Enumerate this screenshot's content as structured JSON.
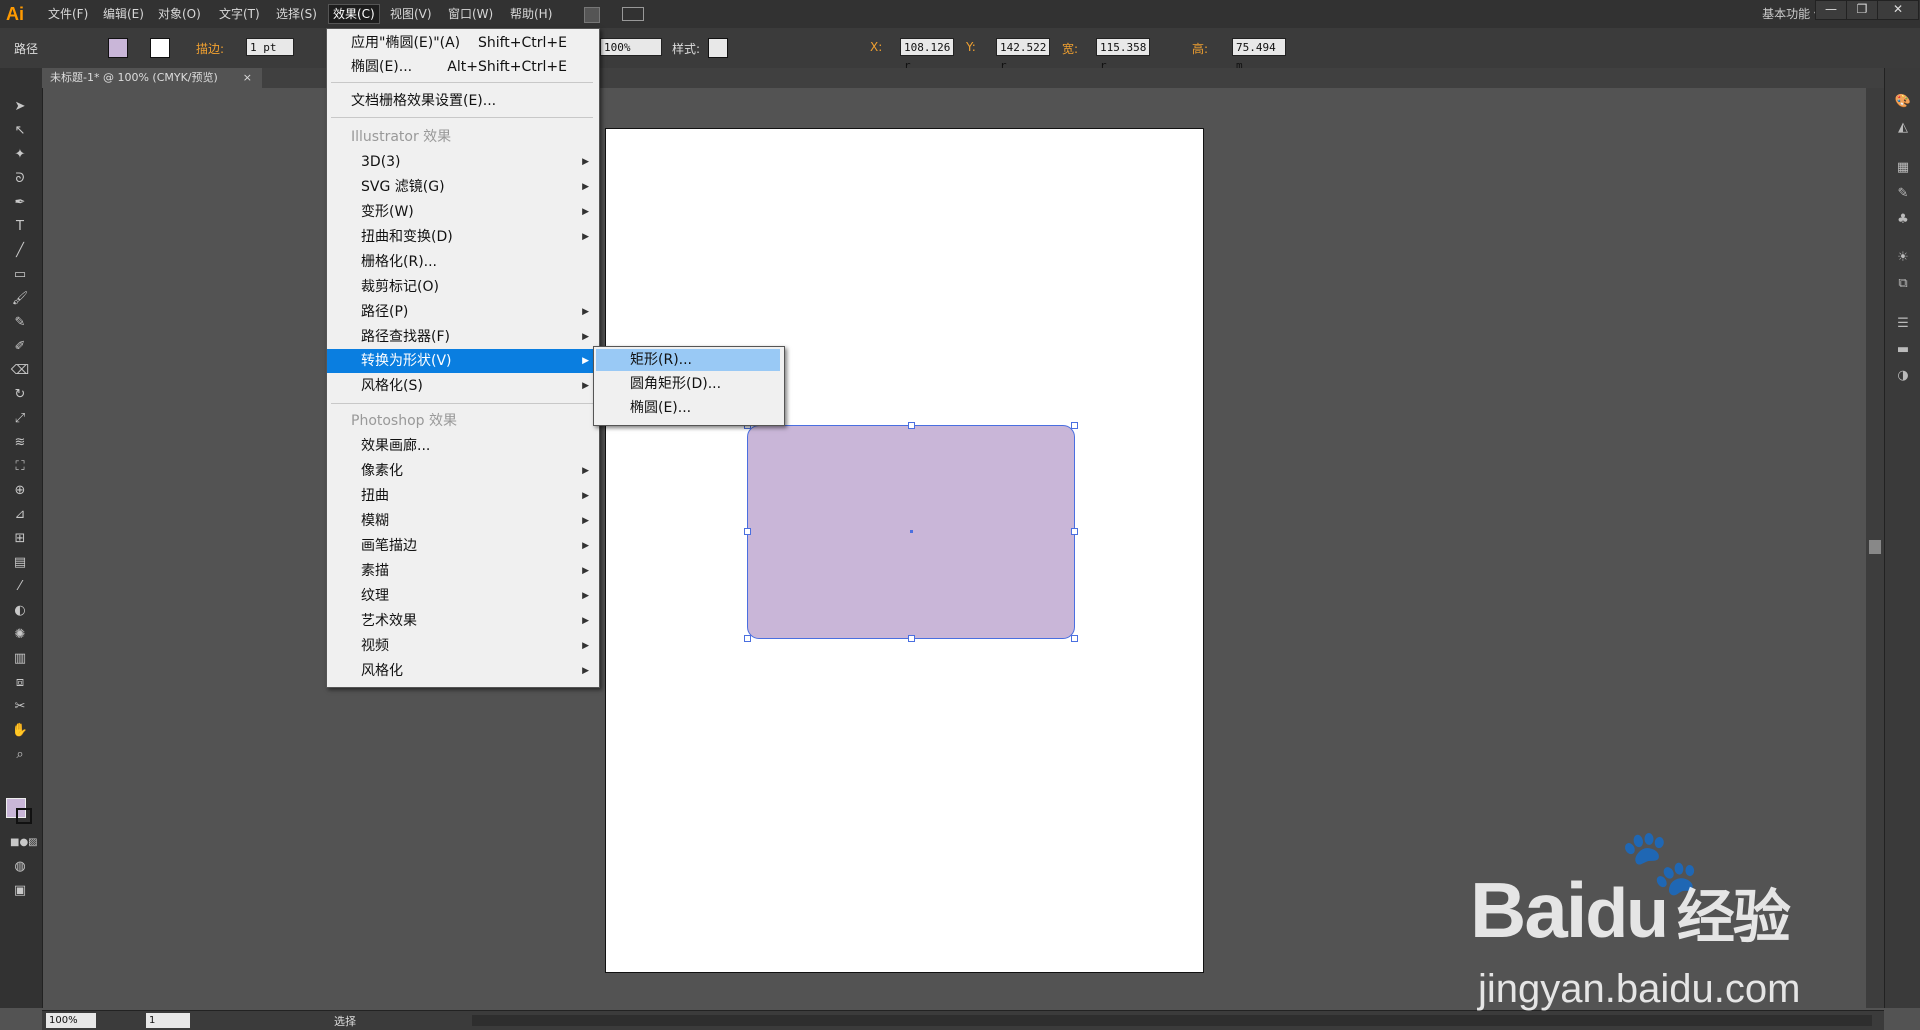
{
  "app": {
    "logo": "Ai",
    "workspace": "基本功能"
  },
  "menubar": {
    "items": [
      "文件(F)",
      "编辑(E)",
      "对象(O)",
      "文字(T)",
      "选择(S)",
      "效果(C)",
      "视图(V)",
      "窗口(W)",
      "帮助(H)"
    ],
    "active": "效果(C)"
  },
  "control_bar": {
    "object_type": "路径",
    "stroke_label": "描边:",
    "stroke_value": "1 pt",
    "opacity_value": "100%",
    "style_label": "样式:",
    "x_label": "X:",
    "x_value": "108.126 r",
    "y_label": "Y:",
    "y_value": "142.522 r",
    "w_label": "宽:",
    "w_value": "115.358 r",
    "h_label": "高:",
    "h_value": "75.494 m",
    "fill_color": "#c9b6d8"
  },
  "document_tab": {
    "title": "未标题-1* @ 100% (CMYK/预览)",
    "close": "×"
  },
  "effect_menu": {
    "apply_last": {
      "label": "应用\"椭圆(E)\"(A)",
      "shortcut": "Shift+Ctrl+E"
    },
    "last_effect": {
      "label": "椭圆(E)...",
      "shortcut": "Alt+Shift+Ctrl+E"
    },
    "raster_settings": "文档栅格效果设置(E)...",
    "illustrator_header": "Illustrator 效果",
    "illustrator_items": [
      "3D(3)",
      "SVG 滤镜(G)",
      "变形(W)",
      "扭曲和变换(D)",
      "栅格化(R)...",
      "裁剪标记(O)",
      "路径(P)",
      "路径查找器(F)",
      "转换为形状(V)",
      "风格化(S)"
    ],
    "photoshop_header": "Photoshop 效果",
    "photoshop_items": [
      "效果画廊...",
      "像素化",
      "扭曲",
      "模糊",
      "画笔描边",
      "素描",
      "纹理",
      "艺术效果",
      "视频",
      "风格化"
    ]
  },
  "convert_submenu": {
    "items": [
      "矩形(R)...",
      "圆角矩形(D)...",
      "椭圆(E)..."
    ],
    "highlighted": "矩形(R)..."
  },
  "status_bar": {
    "zoom": "100%",
    "page": "1",
    "tool": "选择"
  },
  "shape": {
    "fill": "#c9b6d8",
    "stroke": "#4a6fe0"
  },
  "watermark": {
    "brand": "Bai",
    "brand_cn": "经验",
    "url": "jingyan.baidu.com"
  }
}
